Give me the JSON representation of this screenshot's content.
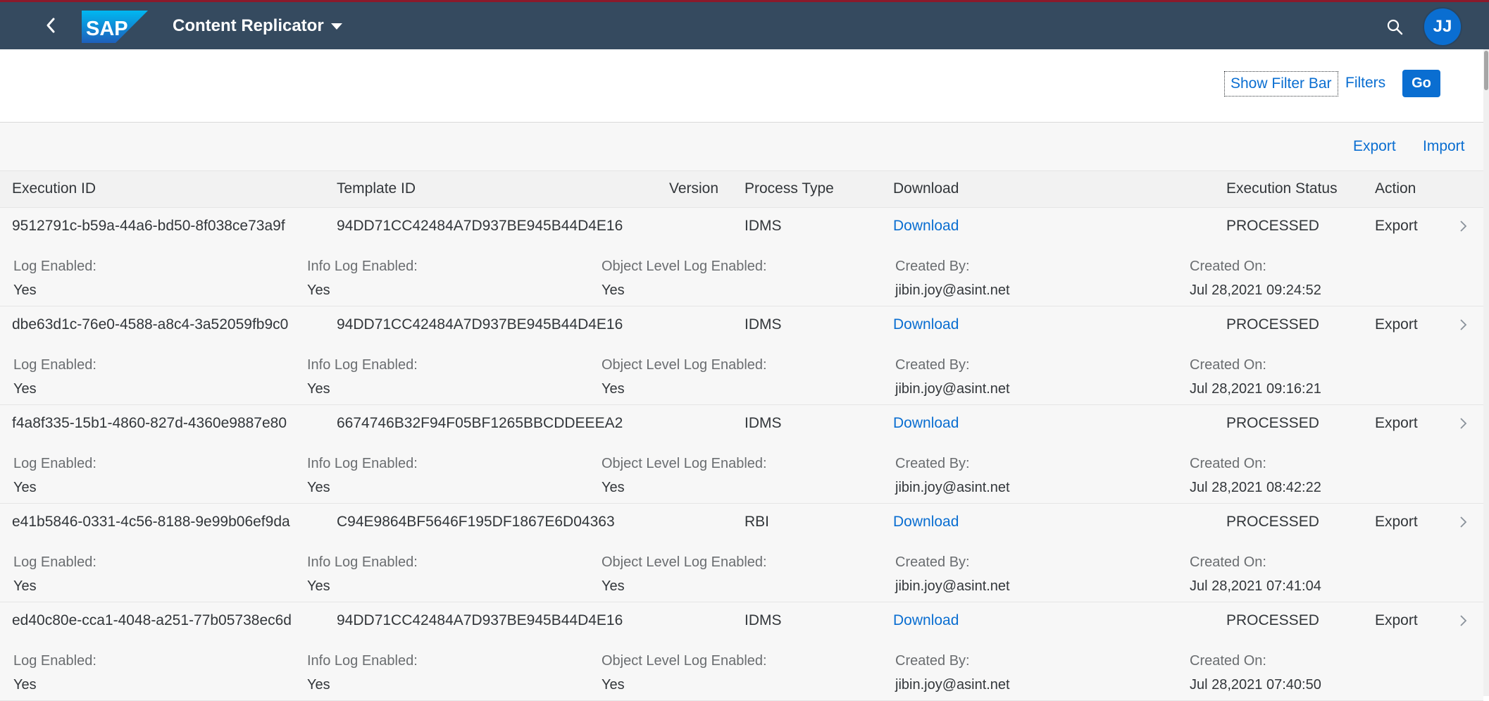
{
  "shell": {
    "app_title": "Content Replicator",
    "logo_text": "SAP",
    "avatar_initials": "JJ",
    "icons": {
      "back": "chevron-left-icon",
      "search": "search-icon",
      "title_menu": "caret-down-icon"
    }
  },
  "filter_bar": {
    "show_filter_bar_label": "Show Filter Bar",
    "filters_label": "Filters",
    "go_label": "Go"
  },
  "toolbar": {
    "export_label": "Export",
    "import_label": "Import"
  },
  "table": {
    "columns": {
      "execution_id": "Execution ID",
      "template_id": "Template ID",
      "version": "Version",
      "process_type": "Process Type",
      "download": "Download",
      "execution_status": "Execution Status",
      "action": "Action"
    },
    "detail_labels": {
      "log_enabled": "Log Enabled:",
      "info_log_enabled": "Info Log Enabled:",
      "object_level_log_enabled": "Object Level Log Enabled:",
      "created_by": "Created By:",
      "created_on": "Created On:"
    },
    "rows": [
      {
        "execution_id": "9512791c-b59a-44a6-bd50-8f038ce73a9f",
        "template_id": "94DD71CC42484A7D937BE945B44D4E16",
        "version": "",
        "process_type": "IDMS",
        "download": "Download",
        "execution_status": "PROCESSED",
        "action": "Export",
        "log_enabled": "Yes",
        "info_log_enabled": "Yes",
        "object_level_log_enabled": "Yes",
        "created_by": "jibin.joy@asint.net",
        "created_on": "Jul 28,2021 09:24:52"
      },
      {
        "execution_id": "dbe63d1c-76e0-4588-a8c4-3a52059fb9c0",
        "template_id": "94DD71CC42484A7D937BE945B44D4E16",
        "version": "",
        "process_type": "IDMS",
        "download": "Download",
        "execution_status": "PROCESSED",
        "action": "Export",
        "log_enabled": "Yes",
        "info_log_enabled": "Yes",
        "object_level_log_enabled": "Yes",
        "created_by": "jibin.joy@asint.net",
        "created_on": "Jul 28,2021 09:16:21"
      },
      {
        "execution_id": "f4a8f335-15b1-4860-827d-4360e9887e80",
        "template_id": "6674746B32F94F05BF1265BBCDDEEEA2",
        "version": "",
        "process_type": "IDMS",
        "download": "Download",
        "execution_status": "PROCESSED",
        "action": "Export",
        "log_enabled": "Yes",
        "info_log_enabled": "Yes",
        "object_level_log_enabled": "Yes",
        "created_by": "jibin.joy@asint.net",
        "created_on": "Jul 28,2021 08:42:22"
      },
      {
        "execution_id": "e41b5846-0331-4c56-8188-9e99b06ef9da",
        "template_id": "C94E9864BF5646F195DF1867E6D04363",
        "version": "",
        "process_type": "RBI",
        "download": "Download",
        "execution_status": "PROCESSED",
        "action": "Export",
        "log_enabled": "Yes",
        "info_log_enabled": "Yes",
        "object_level_log_enabled": "Yes",
        "created_by": "jibin.joy@asint.net",
        "created_on": "Jul 28,2021 07:41:04"
      },
      {
        "execution_id": "ed40c80e-cca1-4048-a251-77b05738ec6d",
        "template_id": "94DD71CC42484A7D937BE945B44D4E16",
        "version": "",
        "process_type": "IDMS",
        "download": "Download",
        "execution_status": "PROCESSED",
        "action": "Export",
        "log_enabled": "Yes",
        "info_log_enabled": "Yes",
        "object_level_log_enabled": "Yes",
        "created_by": "jibin.joy@asint.net",
        "created_on": "Jul 28,2021 07:40:50"
      }
    ]
  },
  "colors": {
    "shell_background": "#354a5f",
    "shell_top_border": "#8b1a2b",
    "accent": "#0a6ed1",
    "row_background": "#f7f7f7",
    "text": "#32363a",
    "label_text": "#6a6d70"
  }
}
